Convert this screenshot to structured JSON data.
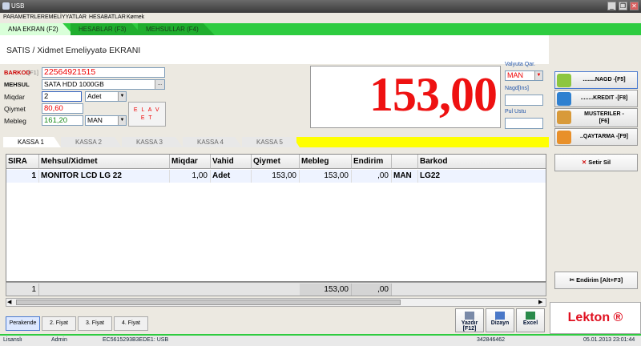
{
  "window": {
    "title": "USB",
    "minimize": "_",
    "restore": "❐",
    "close": "✕"
  },
  "menu": [
    "PARAMETRLER",
    "EMELİYYATLAR",
    "HESABATLAR",
    "Kømek"
  ],
  "top_tabs": [
    "ANA EKRAN (F2)",
    "HESABLAR (F3)",
    "MEHSULLAR (F4)"
  ],
  "page_title": "SATIS / Xidmet Emeliyyatə EKRANI",
  "form": {
    "barcode_label": "BARKOD",
    "barcode_key": "[F1]",
    "barcode_value": "22564921515",
    "product_label": "MEHSUL",
    "product_value": "SATA HDD 1000GB",
    "product_btn": "...",
    "qty_label": "Miqdar",
    "qty_value": "2",
    "unit_value": "Adet",
    "price_label": "Qiymet",
    "price_value": "80,60",
    "amount_label": "Mebleg",
    "amount_value": "161,20",
    "currency_value": "MAN",
    "add_button_l1": "E L A V",
    "add_button_l2": "E T"
  },
  "total": "153,00",
  "currency_panel": {
    "currency_label": "Valyuta Qar.",
    "currency_value": "MAN",
    "cash_label": "Nagd[Ins]",
    "change_label": "Pul Ustu"
  },
  "right_panel": {
    "cash_button": "........NAGD -[F5]",
    "credit_button": "........KREDIT -[F8]",
    "customers_button_l1": "MUSTERILER -",
    "customers_button_l2": "[F6]",
    "return_button": "..QAYTARMA -[F9]",
    "delete_row_button": "Setir Sil",
    "discount_button": "Endirim [Alt+F3]",
    "brand": "Lekton ®"
  },
  "kassa_tabs": [
    "KASSA 1",
    "KASSA 2",
    "KASSA 3",
    "KASSA 4",
    "KASSA 5"
  ],
  "grid": {
    "headers": [
      "SIRA",
      "Mehsul/Xidmet",
      "Miqdar",
      "Vahid",
      "Qiymet",
      "Mebleg",
      "Endirim",
      "",
      "Barkod"
    ],
    "rows": [
      [
        "1",
        "MONITOR LCD LG 22",
        "1,00",
        "Adet",
        "153,00",
        "153,00",
        ",00",
        "MAN",
        "LG22"
      ]
    ],
    "footer": {
      "count": "1",
      "total": "153,00",
      "discount": ",00"
    }
  },
  "bottom": {
    "price_buttons": [
      "Perakende",
      "2. Fiyat",
      "3. Fiyat",
      "4. Fiyat"
    ],
    "print_l1": "Yazdır",
    "print_l2": "[F12]",
    "design": "Dizayn",
    "excel": "Excel"
  },
  "status": {
    "license": "Lisanslı",
    "user": "Admin",
    "device": "EC5615293B3EDE1: USB",
    "code": "342846462",
    "datetime": "05.01.2013 23:01:44"
  }
}
